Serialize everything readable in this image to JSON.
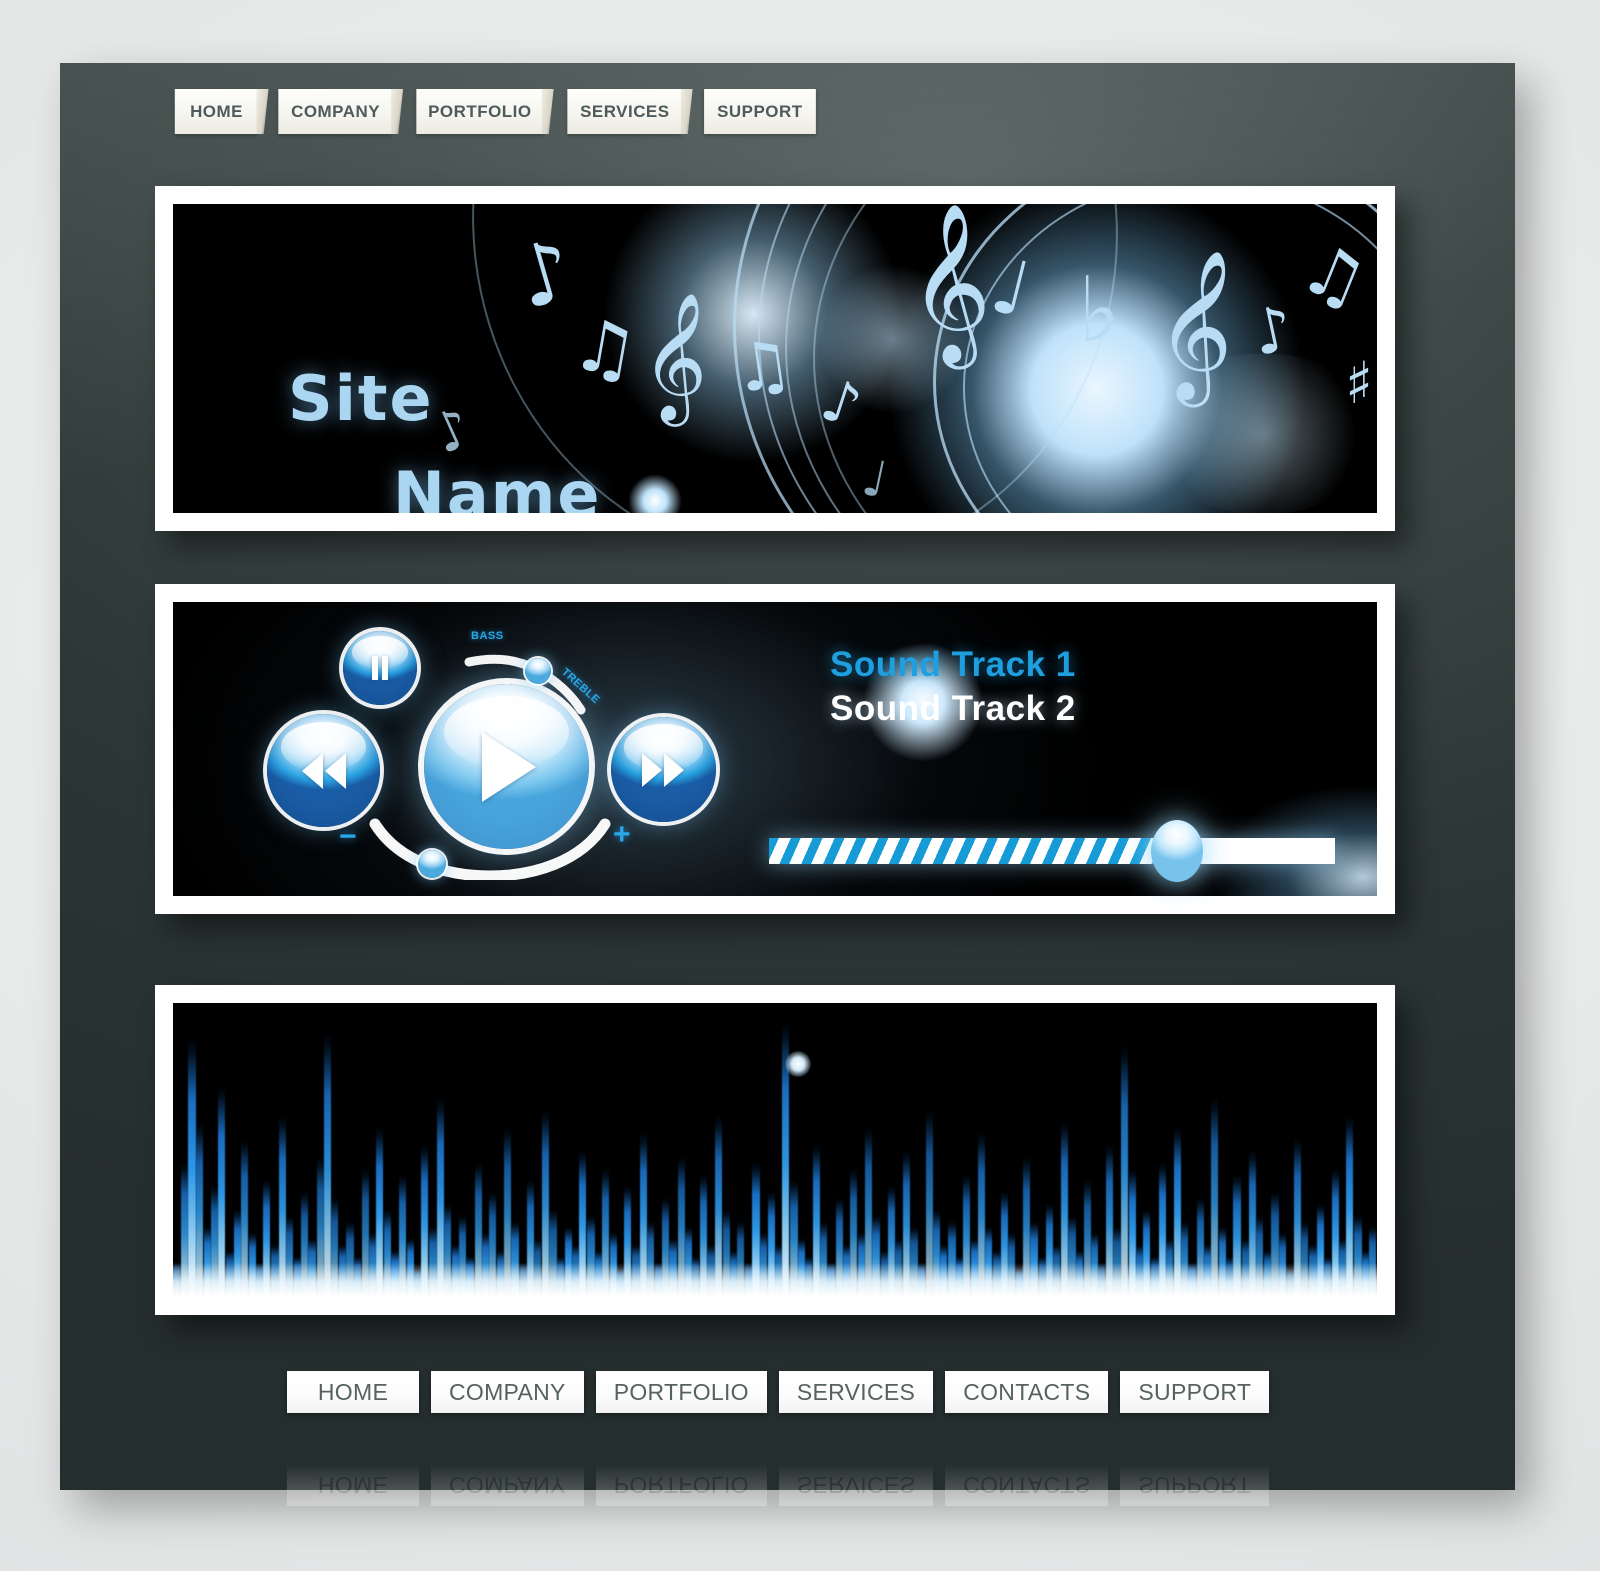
{
  "site": {
    "title_line1": "Site",
    "title_line2": "Name"
  },
  "top_nav": {
    "items": [
      {
        "label": "HOME",
        "active": true
      },
      {
        "label": "COMPANY",
        "active": false
      },
      {
        "label": "PORTFOLIO",
        "active": false
      },
      {
        "label": "SERVICES",
        "active": false
      },
      {
        "label": "SUPPORT",
        "active": false
      }
    ]
  },
  "player": {
    "controls": [
      {
        "name": "pause",
        "icon": "pause-icon"
      },
      {
        "name": "previous",
        "icon": "rewind-icon"
      },
      {
        "name": "play",
        "icon": "play-icon"
      },
      {
        "name": "next",
        "icon": "fast-forward-icon"
      }
    ],
    "equalizer_slider": {
      "left_label": "BASS",
      "right_label": "TREBLE"
    },
    "volume_slider": {
      "minus_label": "−",
      "plus_label": "+"
    },
    "tracks": [
      {
        "label": "Sound  Track 1",
        "color": "#1e9fe0",
        "active": true
      },
      {
        "label": "Sound  Track 2",
        "color": "#ffffff",
        "active": false
      }
    ],
    "progress": {
      "percent": 72,
      "fill_color": "#169bd7",
      "track_color": "#ffffff"
    }
  },
  "bottom_nav": {
    "items": [
      {
        "label": "HOME"
      },
      {
        "label": "COMPANY"
      },
      {
        "label": "PORTFOLIO"
      },
      {
        "label": "SERVICES"
      },
      {
        "label": "CONTACTS"
      },
      {
        "label": "SUPPORT"
      }
    ]
  },
  "theme": {
    "page_background": "#2c3636",
    "banner_background": "#000000",
    "frame_color": "#ffffff",
    "accent_blue": "#1e9fe0",
    "title_blue": "#aad6f2",
    "nav_text": "#56625f"
  },
  "visualizer": {
    "bar_levels": [
      12,
      46,
      88,
      60,
      24,
      38,
      72,
      16,
      30,
      54,
      22,
      12,
      40,
      18,
      62,
      28,
      14,
      36,
      20,
      48,
      90,
      34,
      18,
      26,
      14,
      44,
      22,
      58,
      30,
      16,
      42,
      20,
      10,
      52,
      24,
      68,
      32,
      18,
      28,
      14,
      46,
      22,
      36,
      16,
      58,
      26,
      12,
      40,
      20,
      64,
      30,
      14,
      24,
      18,
      50,
      28,
      16,
      44,
      22,
      10,
      38,
      18,
      56,
      26,
      12,
      34,
      20,
      48,
      24,
      14,
      42,
      18,
      62,
      30,
      16,
      26,
      12,
      46,
      22,
      36,
      18,
      94,
      40,
      20,
      14,
      52,
      26,
      12,
      34,
      18,
      44,
      22,
      58,
      28,
      16,
      38,
      20,
      50,
      24,
      12,
      64,
      30,
      18,
      26,
      14,
      42,
      20,
      56,
      24,
      16,
      36,
      22,
      10,
      48,
      26,
      14,
      32,
      18,
      60,
      28,
      16,
      40,
      22,
      12,
      52,
      24,
      86,
      44,
      18,
      30,
      14,
      46,
      20,
      58,
      26,
      12,
      34,
      18,
      68,
      24,
      14,
      42,
      20,
      50,
      28,
      16,
      36,
      22,
      10,
      54,
      26,
      18,
      32,
      14,
      44,
      20,
      62,
      28,
      16,
      24
    ]
  }
}
